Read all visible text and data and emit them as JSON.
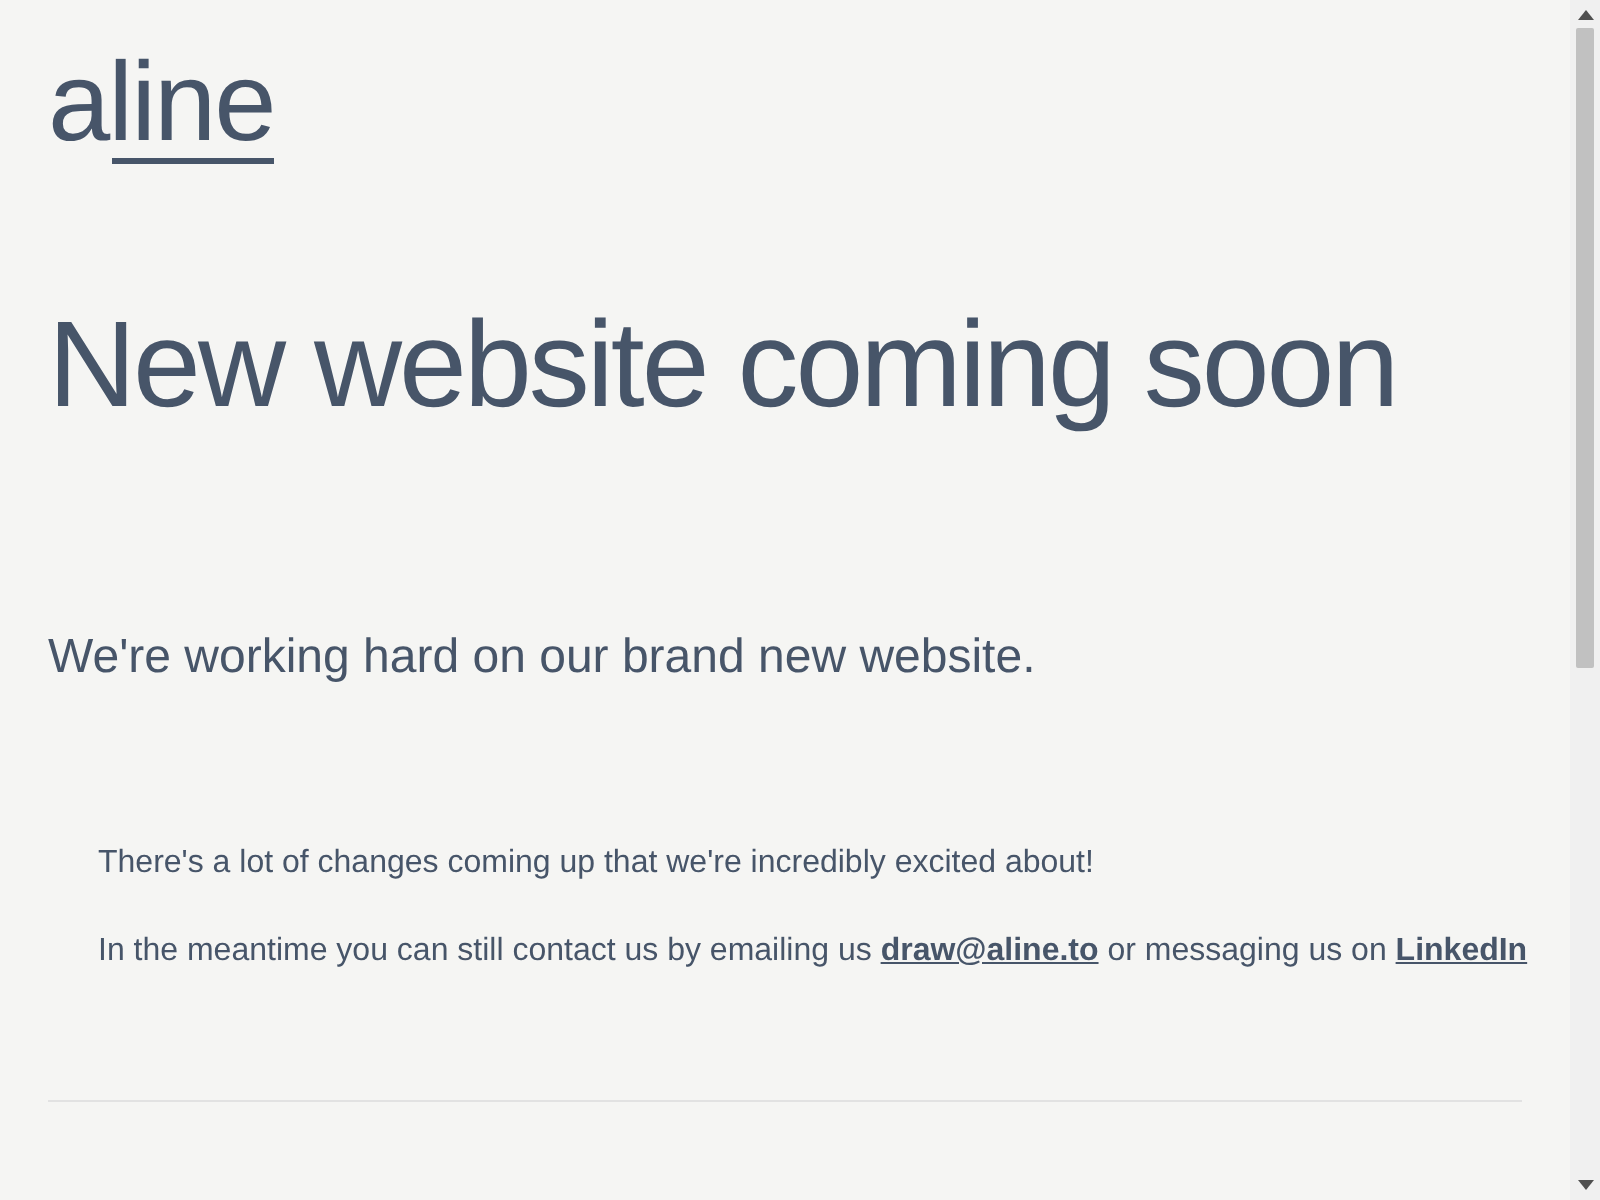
{
  "logo": "aline",
  "heading": "New website coming soon",
  "subheading": "We're working hard on our brand new website.",
  "paragraphs": [
    {
      "text": "There's a lot of changes coming up that we're incredibly excited about!"
    },
    {
      "text": "In the meantime you can still contact us by emailing us",
      "links": [
        {
          "label": "draw@aline.to",
          "after": "or messaging us on"
        },
        {
          "label": "LinkedIn"
        }
      ]
    }
  ]
}
